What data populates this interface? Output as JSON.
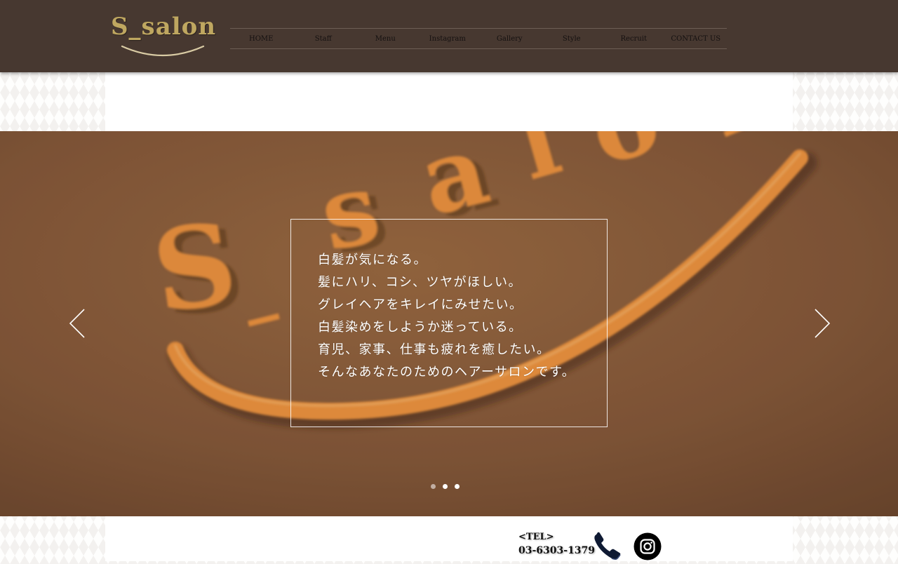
{
  "brand": {
    "logo_text": "S_salon"
  },
  "nav": {
    "items": [
      {
        "label": "HOME",
        "active": true
      },
      {
        "label": "Staff",
        "active": false
      },
      {
        "label": "Menu",
        "active": false
      },
      {
        "label": "Instagram",
        "active": false
      },
      {
        "label": "Gallery",
        "active": false
      },
      {
        "label": "Style",
        "active": false
      },
      {
        "label": "Recruit",
        "active": false
      },
      {
        "label": "CONTACT US",
        "active": false
      }
    ]
  },
  "hero": {
    "lines": [
      "白髪が気になる。",
      "髪にハリ、コシ、ツヤがほしい。",
      "グレイヘアをキレイにみせたい。",
      "白髪染めをしようか迷っている。",
      "育児、家事、仕事も疲れを癒したい。",
      "そんなあなたのためのヘアーサロンです。"
    ],
    "sign_text": "S_salon",
    "slides_total": 3,
    "active_slide": 2
  },
  "contact": {
    "tel_label": "<TEL>",
    "tel_number": "03-6303-1379"
  },
  "icons": [
    "chevron-left-icon",
    "chevron-right-icon",
    "phone-icon",
    "instagram-icon"
  ],
  "colors": {
    "header_bg": "#473830",
    "nav_active": "#a08e56",
    "logo_gold": "#bfa760",
    "hero_bg": "#8a5d3a",
    "sign_orange": "#f0953f"
  }
}
